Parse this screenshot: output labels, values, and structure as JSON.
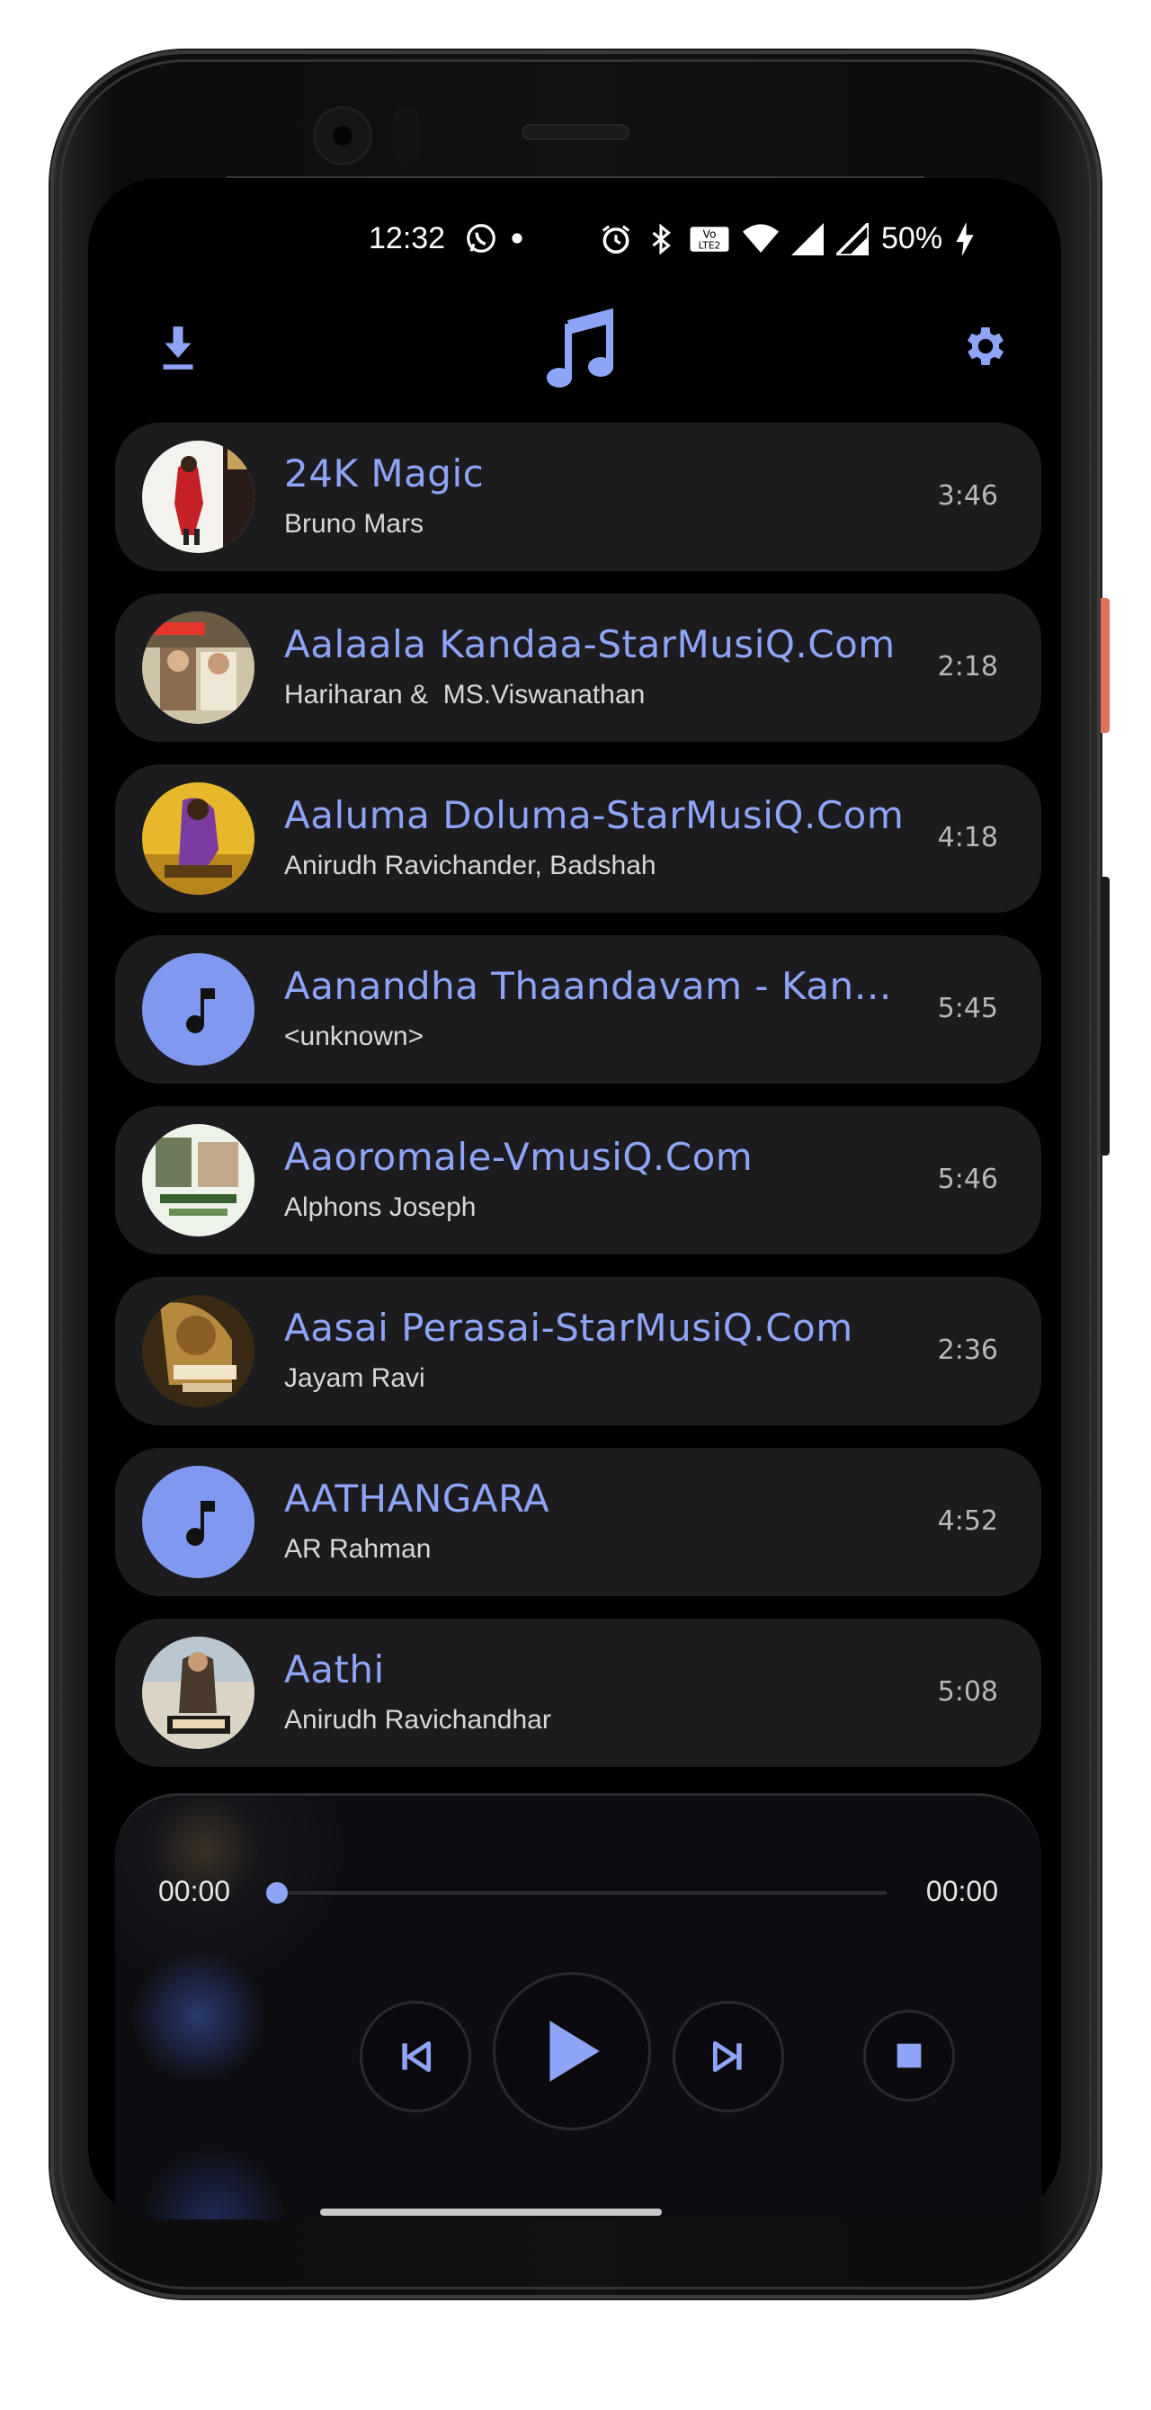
{
  "status_bar": {
    "time": "12:32",
    "battery": "50%",
    "icons": [
      "whatsapp-icon",
      "dot-icon",
      "alarm-icon",
      "bluetooth-icon",
      "volte-icon",
      "wifi-icon",
      "signal-icon",
      "signal-icon",
      "charging-icon"
    ]
  },
  "app_bar": {
    "icons": [
      "download-icon",
      "music-note-icon",
      "settings-icon"
    ]
  },
  "songs": [
    {
      "title": "24K Magic",
      "artist": "Bruno Mars",
      "duration": "3:46",
      "art": "album-art"
    },
    {
      "title": "Aalaala Kandaa-StarMusiQ.Com",
      "artist": "Hariharan &  MS.Viswanathan",
      "duration": "2:18",
      "art": "album-art"
    },
    {
      "title": "Aaluma Doluma-StarMusiQ.Com",
      "artist": "Anirudh Ravichander, Badshah",
      "duration": "4:18",
      "art": "album-art"
    },
    {
      "title": "Aanandha Thaandavam - Kanaa...",
      "artist": "<unknown>",
      "duration": "5:45",
      "art": "placeholder-note"
    },
    {
      "title": "Aaoromale-VmusiQ.Com",
      "artist": "Alphons Joseph",
      "duration": "5:46",
      "art": "album-art"
    },
    {
      "title": "Aasai Perasai-StarMusiQ.Com",
      "artist": "Jayam Ravi",
      "duration": "2:36",
      "art": "album-art"
    },
    {
      "title": "AATHANGARA",
      "artist": "AR Rahman",
      "duration": "4:52",
      "art": "placeholder-note"
    },
    {
      "title": "Aathi",
      "artist": "Anirudh Ravichandhar",
      "duration": "5:08",
      "art": "album-art"
    }
  ],
  "player": {
    "current_time": "00:00",
    "total_time": "00:00",
    "progress": 0,
    "controls": [
      "skip-previous-icon",
      "play-icon",
      "skip-next-icon",
      "stop-icon"
    ]
  },
  "colors": {
    "accent": "#8ea4f6",
    "card": "#1c1c1e",
    "background": "#000000"
  }
}
